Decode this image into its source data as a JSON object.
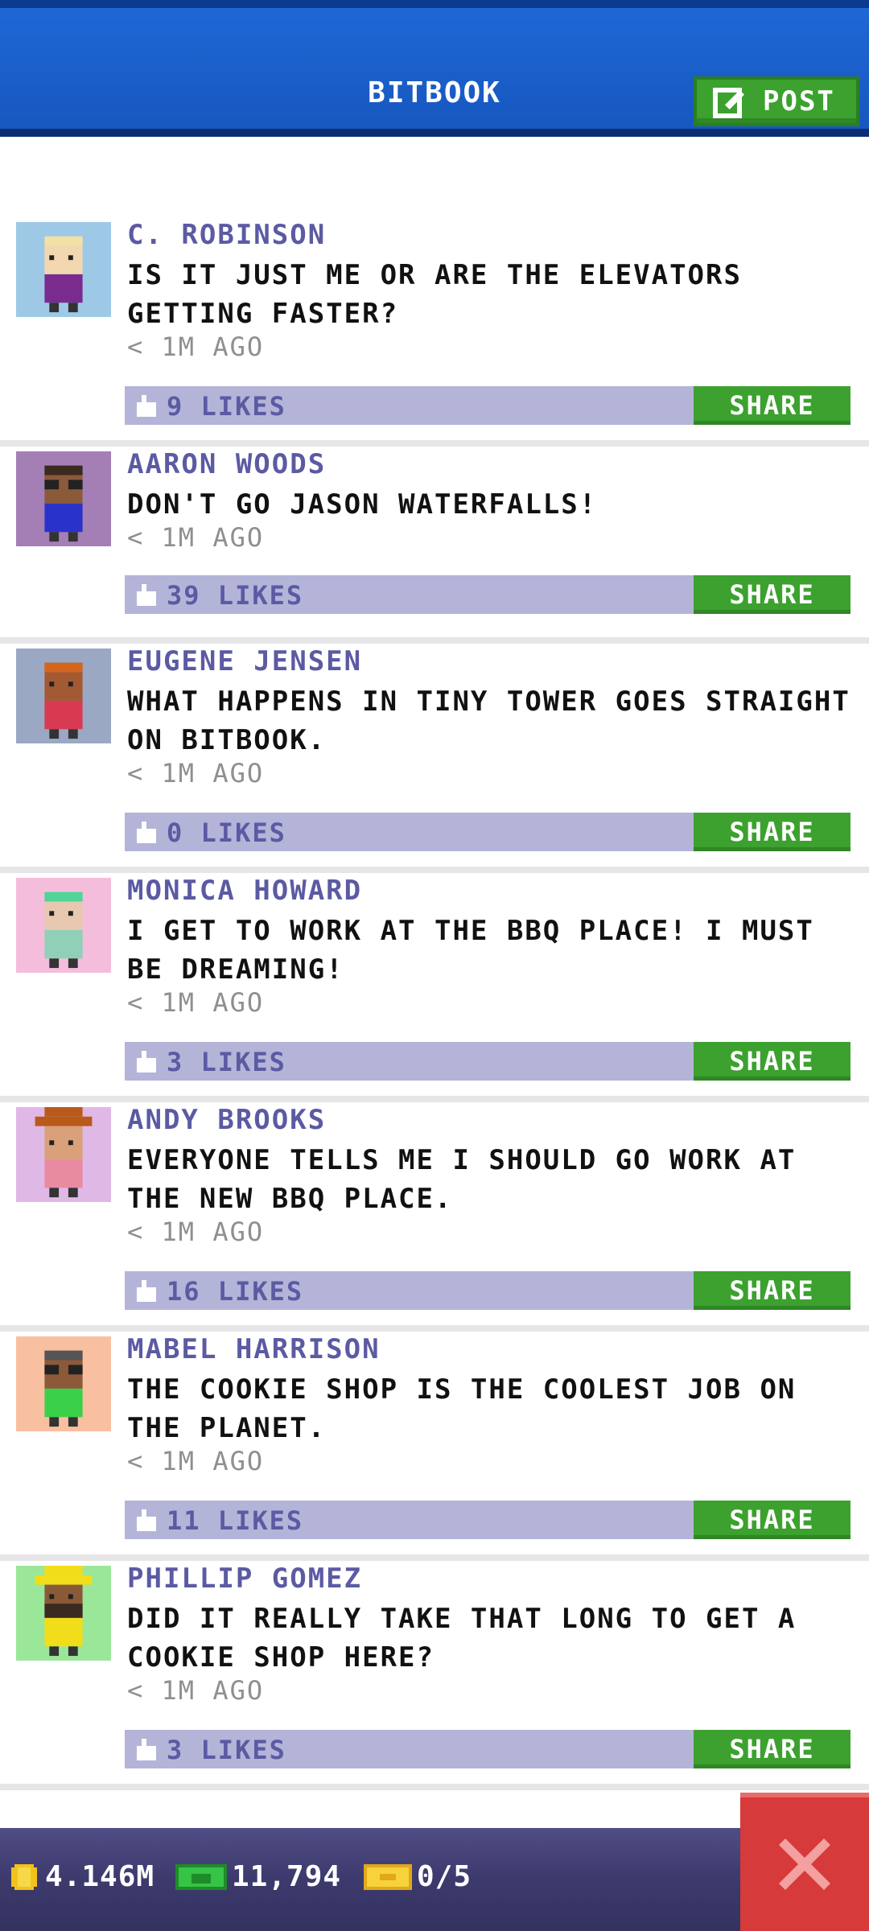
{
  "header": {
    "title": "BITBOOK",
    "post_label": "POST"
  },
  "posts": [
    {
      "name": "C. ROBINSON",
      "message": "IS IT JUST ME OR ARE THE ELEVATORS GETTING FASTER?",
      "time": "< 1M AGO",
      "likes": "9 LIKES",
      "share_label": "SHARE",
      "avatar_bg": "#9ec9e6"
    },
    {
      "name": "AARON WOODS",
      "message": "DON'T GO JASON WATERFALLS!",
      "time": "< 1M AGO",
      "likes": "39 LIKES",
      "share_label": "SHARE",
      "avatar_bg": "#a47fb5"
    },
    {
      "name": "EUGENE JENSEN",
      "message": "WHAT HAPPENS IN TINY TOWER GOES STRAIGHT ON BITBOOK.",
      "time": "< 1M AGO",
      "likes": "0 LIKES",
      "share_label": "SHARE",
      "avatar_bg": "#9aa8c4"
    },
    {
      "name": "MONICA HOWARD",
      "message": "I GET TO WORK AT THE BBQ PLACE! I MUST BE DREAMING!",
      "time": "< 1M AGO",
      "likes": "3 LIKES",
      "share_label": "SHARE",
      "avatar_bg": "#f4bddc"
    },
    {
      "name": "ANDY BROOKS",
      "message": "EVERYONE TELLS ME I SHOULD GO WORK AT THE NEW BBQ PLACE.",
      "time": "< 1M AGO",
      "likes": "16 LIKES",
      "share_label": "SHARE",
      "avatar_bg": "#e0b8e6"
    },
    {
      "name": "MABEL HARRISON",
      "message": "THE COOKIE SHOP IS THE COOLEST JOB ON THE PLANET.",
      "time": "< 1M AGO",
      "likes": "11 LIKES",
      "share_label": "SHARE",
      "avatar_bg": "#f8c0a0"
    },
    {
      "name": "PHILLIP GOMEZ",
      "message": "DID IT REALLY TAKE THAT LONG TO GET A COOKIE SHOP HERE?",
      "time": "< 1M AGO",
      "likes": "3 LIKES",
      "share_label": "SHARE",
      "avatar_bg": "#9be79a"
    }
  ],
  "status": {
    "coins": "4.146M",
    "bux": "11,794",
    "tickets": "0/5"
  },
  "colors": {
    "header_blue": "#1757bf",
    "share_green": "#3ca12f",
    "likebar": "#b4b4d9",
    "name_purple": "#5b5aa3",
    "close_red": "#d63a3a"
  },
  "icons": {
    "post": "edit-icon",
    "like": "thumbs-up-icon",
    "coin": "coin-icon",
    "bux": "bux-icon",
    "ticket": "ticket-icon",
    "close": "close-icon"
  }
}
